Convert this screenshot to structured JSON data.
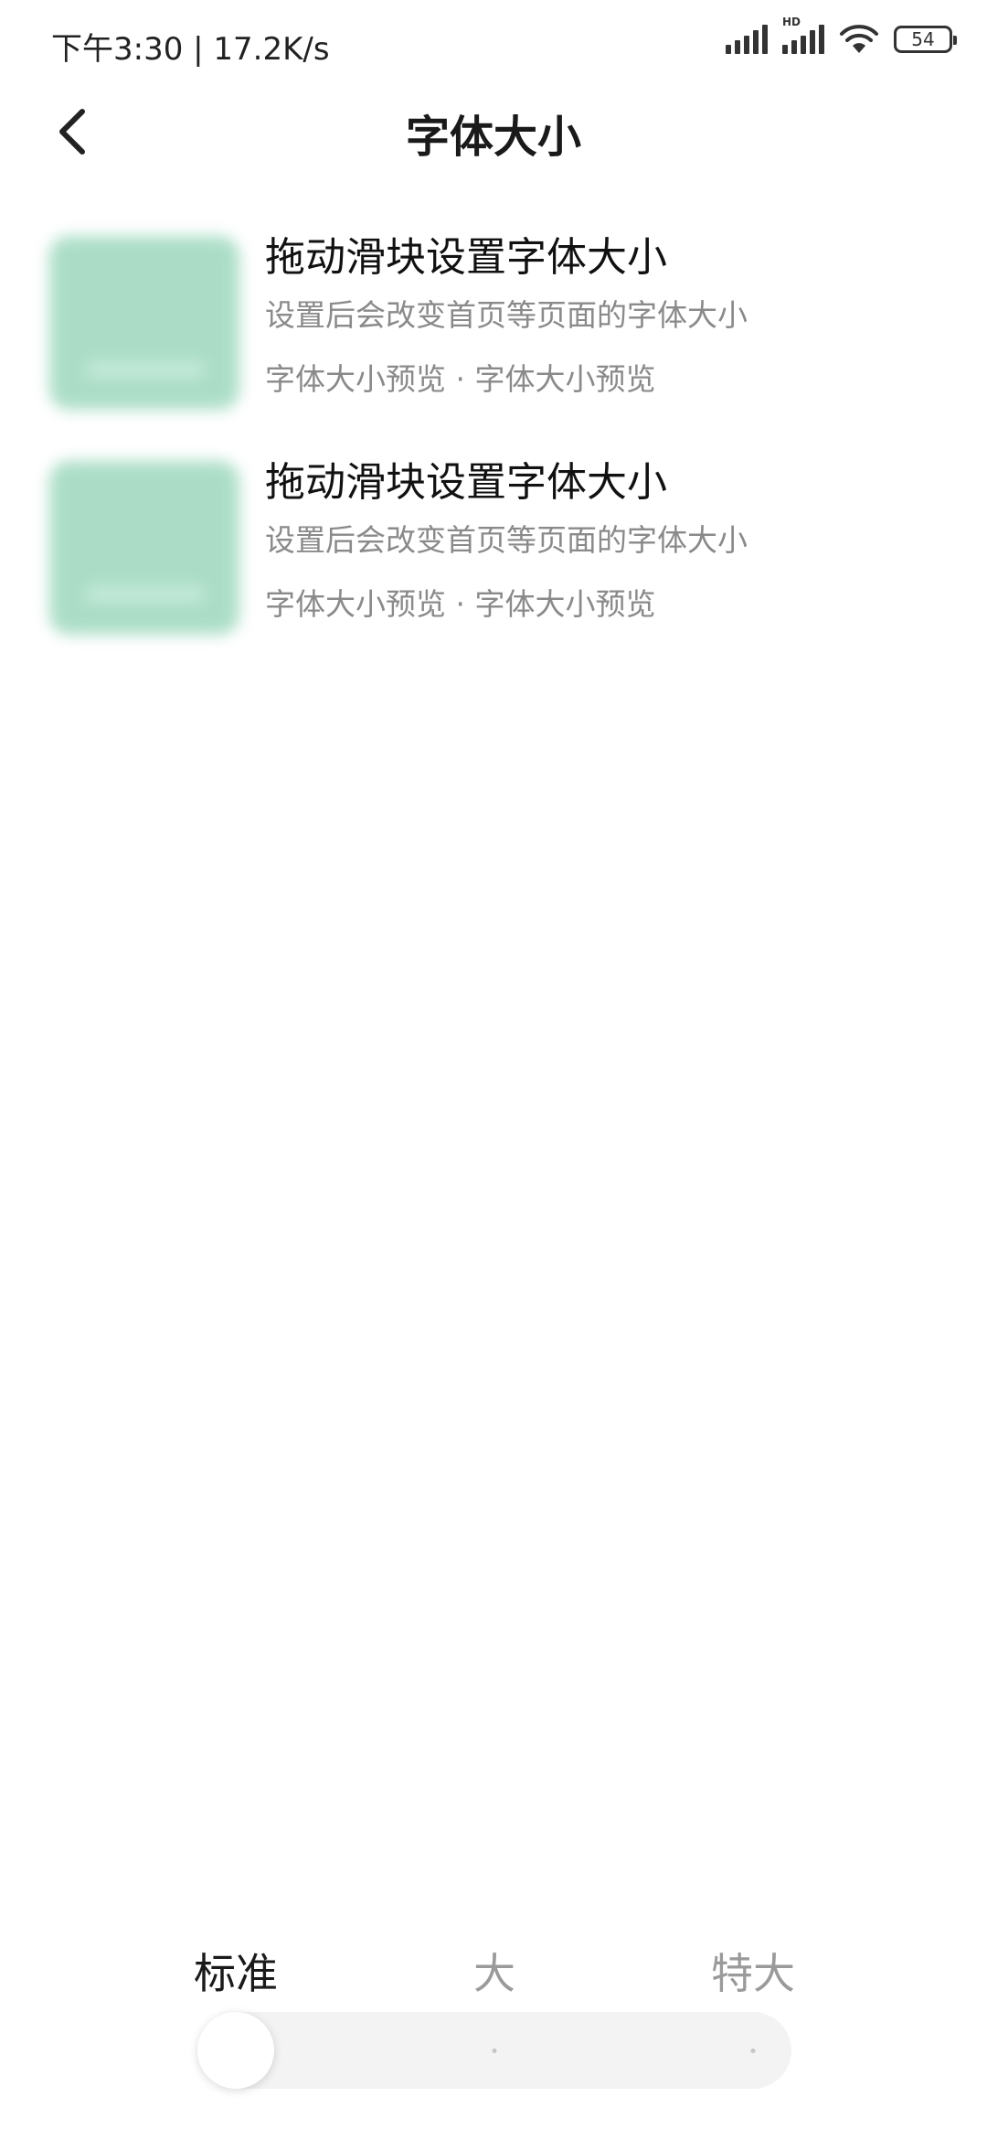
{
  "status_bar": {
    "time": "下午3:30 | 17.2K/s",
    "battery": "54",
    "hd_label": "HD",
    "icons": [
      "signal-icon",
      "hd-signal-icon",
      "wifi-icon",
      "battery-icon"
    ]
  },
  "header": {
    "title": "字体大小",
    "back_icon": "chevron-left-icon"
  },
  "preview_items": [
    {
      "title": "拖动滑块设置字体大小",
      "description": "设置后会改变首页等页面的字体大小",
      "subtext": "字体大小预览 · 字体大小预览"
    },
    {
      "title": "拖动滑块设置字体大小",
      "description": "设置后会改变首页等页面的字体大小",
      "subtext": "字体大小预览 · 字体大小预览"
    }
  ],
  "font_size": {
    "options": [
      "标准",
      "大",
      "特大"
    ],
    "selected_index": 0,
    "selected": "标准"
  },
  "colors": {
    "thumbnail": "#a7dcc4",
    "track": "#f3f3f3",
    "active_text": "#1a1a1a",
    "inactive_text": "#9a9a9a"
  }
}
